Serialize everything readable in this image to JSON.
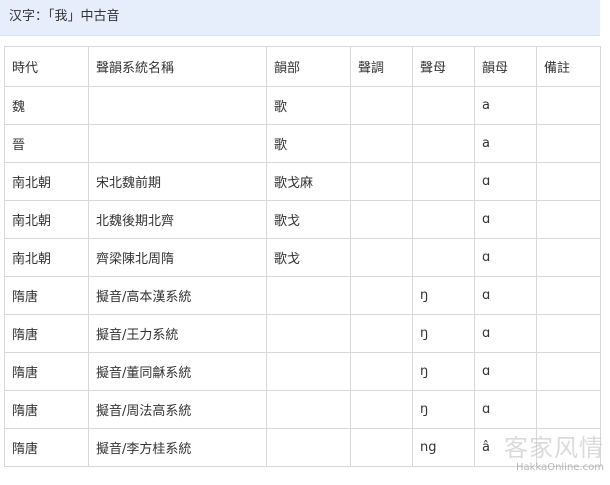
{
  "title": "汉字：「我」中古音",
  "table": {
    "headers": [
      "時代",
      "聲韻系統名稱",
      "韻部",
      "聲調",
      "聲母",
      "韻母",
      "備註"
    ],
    "rows": [
      [
        "魏",
        "",
        "歌",
        "",
        "",
        "a",
        ""
      ],
      [
        "晉",
        "",
        "歌",
        "",
        "",
        "a",
        ""
      ],
      [
        "南北朝",
        "宋北魏前期",
        "歌戈麻",
        "",
        "",
        "ɑ",
        ""
      ],
      [
        "南北朝",
        "北魏後期北齊",
        "歌戈",
        "",
        "",
        "ɑ",
        ""
      ],
      [
        "南北朝",
        "齊梁陳北周隋",
        "歌戈",
        "",
        "",
        "ɑ",
        ""
      ],
      [
        "隋唐",
        "擬音/高本漢系統",
        "",
        "",
        "ŋ",
        "ɑ",
        ""
      ],
      [
        "隋唐",
        "擬音/王力系統",
        "",
        "",
        "ŋ",
        "ɑ",
        ""
      ],
      [
        "隋唐",
        "擬音/董同龢系統",
        "",
        "",
        "ŋ",
        "ɑ",
        ""
      ],
      [
        "隋唐",
        "擬音/周法高系統",
        "",
        "",
        "ŋ",
        "ɑ",
        ""
      ],
      [
        "隋唐",
        "擬音/李方桂系統",
        "",
        "",
        "ng",
        "â",
        ""
      ]
    ]
  },
  "watermark": {
    "glyphs": "客家风情",
    "url": "HakkaOnline.com"
  },
  "colors": {
    "title_background": "#e6eefb",
    "border": "#d8d8d8",
    "text": "#333333"
  }
}
